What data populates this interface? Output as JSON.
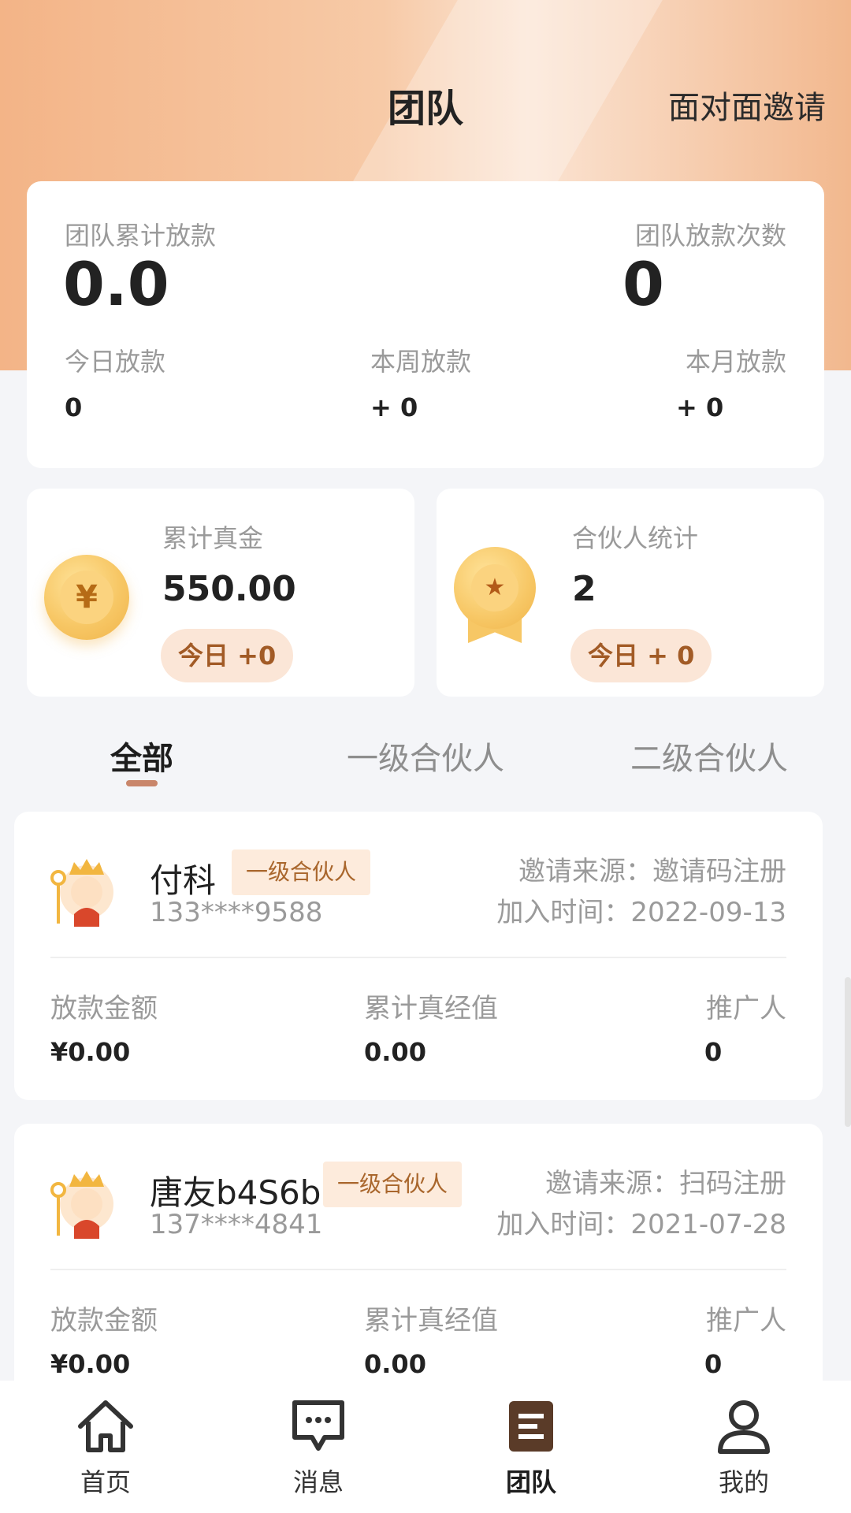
{
  "header": {
    "title": "团队",
    "invite_label": "面对面邀请"
  },
  "summary": {
    "total_label": "团队累计放款",
    "total_value": "0.0",
    "count_label": "团队放款次数",
    "count_value": "0",
    "today_label": "今日放款",
    "today_value": "0",
    "week_label": "本周放款",
    "week_value": "+ 0",
    "month_label": "本月放款",
    "month_value": "+ 0"
  },
  "stats": {
    "gold": {
      "label": "累计真金",
      "value": "550.00",
      "today": "今日 +0",
      "icon": "yen-coin-icon"
    },
    "partner": {
      "label": "合伙人统计",
      "value": "2",
      "today": "今日 + 0",
      "icon": "star-medal-icon"
    }
  },
  "tabs": [
    "全部",
    "一级合伙人",
    "二级合伙人"
  ],
  "members": [
    {
      "name": "付科",
      "badge": "一级合伙人",
      "phone": "133****9588",
      "source": "邀请来源：邀请码注册",
      "join_time": "加入时间：2022-09-13",
      "loan_label": "放款金额",
      "loan_value": "¥0.00",
      "exp_label": "累计真经值",
      "exp_value": "0.00",
      "promoter_label": "推广人",
      "promoter_value": "0"
    },
    {
      "name": "唐友b4S6b",
      "badge": "一级合伙人",
      "phone": "137****4841",
      "source": "邀请来源：扫码注册",
      "join_time": "加入时间：2021-07-28",
      "loan_label": "放款金额",
      "loan_value": "¥0.00",
      "exp_label": "累计真经值",
      "exp_value": "0.00",
      "promoter_label": "推广人",
      "promoter_value": "0"
    }
  ],
  "tabbar": [
    {
      "label": "首页",
      "icon": "home-icon"
    },
    {
      "label": "消息",
      "icon": "message-icon"
    },
    {
      "label": "团队",
      "icon": "team-icon"
    },
    {
      "label": "我的",
      "icon": "profile-icon"
    }
  ],
  "colors": {
    "accent": "#c9866b",
    "badge_text": "#a9662c",
    "badge_bg": "#fdebdc",
    "active_tab_icon": "#5a3b28"
  }
}
